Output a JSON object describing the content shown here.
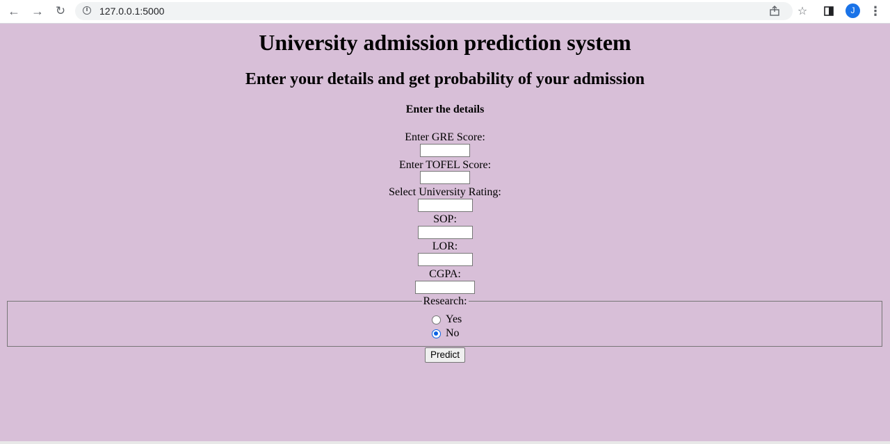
{
  "browser": {
    "url": "127.0.0.1:5000",
    "avatar_letter": "J"
  },
  "page": {
    "title": "University admission prediction system",
    "subtitle": "Enter your details and get probability of your admission",
    "form_heading": "Enter the details",
    "fields": {
      "gre_label": "Enter GRE Score:",
      "gre_value": "",
      "tofel_label": "Enter TOFEL Score:",
      "tofel_value": "",
      "rating_label": "Select University Rating:",
      "rating_value": "",
      "sop_label": "SOP:",
      "sop_value": "",
      "lor_label": "LOR:",
      "lor_value": "",
      "cgpa_label": "CGPA:",
      "cgpa_value": ""
    },
    "research": {
      "legend": "Research:",
      "options": [
        "Yes",
        "No"
      ],
      "selected": "No"
    },
    "predict_label": "Predict"
  },
  "colors": {
    "page_background": "#d8bfd8",
    "radio_accent": "#0b62e3",
    "avatar": "#1a73e8"
  }
}
